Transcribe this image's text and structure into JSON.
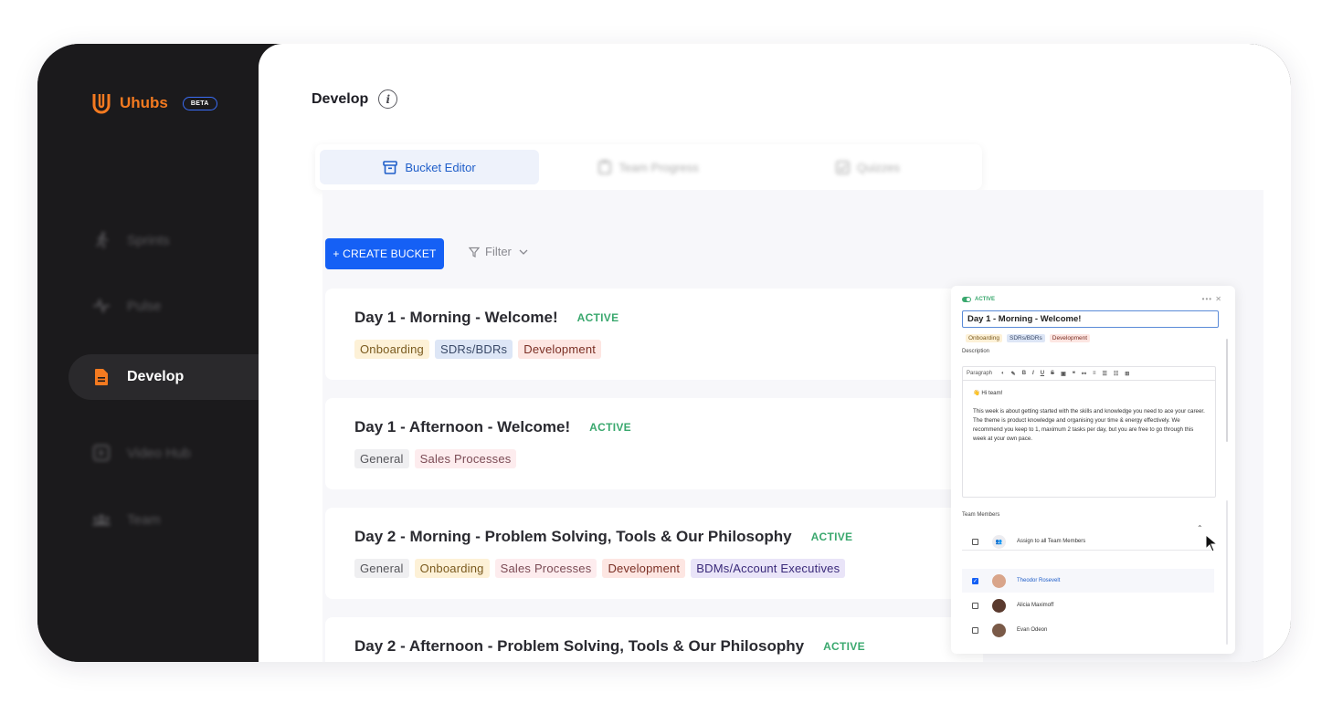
{
  "brand": {
    "name": "Uhubs",
    "badge": "BETA",
    "accent": "#f47a20"
  },
  "sidebar": {
    "items": [
      {
        "label": "Sprints",
        "icon": "running-icon",
        "active": false
      },
      {
        "label": "Pulse",
        "icon": "pulse-icon",
        "active": false
      },
      {
        "label": "Develop",
        "icon": "document-icon",
        "active": true
      },
      {
        "label": "Video Hub",
        "icon": "play-square-icon",
        "active": false
      },
      {
        "label": "Team",
        "icon": "team-icon",
        "active": false
      }
    ]
  },
  "header": {
    "title": "Develop",
    "info_icon": "i"
  },
  "tabs": [
    {
      "label": "Bucket Editor",
      "icon": "archive-icon",
      "active": true
    },
    {
      "label": "Team Progress",
      "icon": "clipboard-icon",
      "active": false
    },
    {
      "label": "Quizzes",
      "icon": "quiz-icon",
      "active": false
    }
  ],
  "toolbar": {
    "create_label": "+ CREATE BUCKET",
    "filter_label": "Filter"
  },
  "buckets": [
    {
      "title": "Day 1 - Morning - Welcome!",
      "status": "ACTIVE",
      "tags": [
        "Onboarding",
        "SDRs/BDRs",
        "Development"
      ]
    },
    {
      "title": "Day 1 - Afternoon - Welcome!",
      "status": "ACTIVE",
      "tags": [
        "General",
        "Sales Processes"
      ]
    },
    {
      "title": "Day 2 - Morning - Problem Solving, Tools & Our Philosophy",
      "status": "ACTIVE",
      "tags": [
        "General",
        "Onboarding",
        "Sales Processes",
        "Development",
        "BDMs/Account Executives"
      ]
    },
    {
      "title": "Day 2 - Afternoon -  Problem Solving, Tools & Our Philosophy",
      "status": "ACTIVE",
      "tags": []
    }
  ],
  "panel": {
    "status": "ACTIVE",
    "actions": "••• ✕",
    "title_value": "Day 1 - Morning - Welcome!",
    "tags": [
      "Onboarding",
      "SDRs/BDRs",
      "Development"
    ],
    "description_label": "Description",
    "editor": {
      "paragraph_label": "Paragraph",
      "tools": [
        "B",
        "I",
        "U",
        "S"
      ],
      "greeting": "👋 Hi team!",
      "body": "This week is about getting started with the skills and knowledge you need to ace your career. The theme is product knowledge and organising your time & energy effectively. We recommend you keep to 1, maximum 2 tasks per day, but you are free to go through this week at your own pace."
    },
    "members_label": "Team Members",
    "assign_all": "Assign to all Team Members",
    "members": [
      {
        "name": "Theodor Rosevelt",
        "checked": true
      },
      {
        "name": "Alicia Maximoff",
        "checked": false
      },
      {
        "name": "Evan Odeon",
        "checked": false
      }
    ]
  },
  "colors": {
    "primary": "#1560f5",
    "active_status": "#3aa86e",
    "sidebar_bg": "#1b1a1c"
  }
}
